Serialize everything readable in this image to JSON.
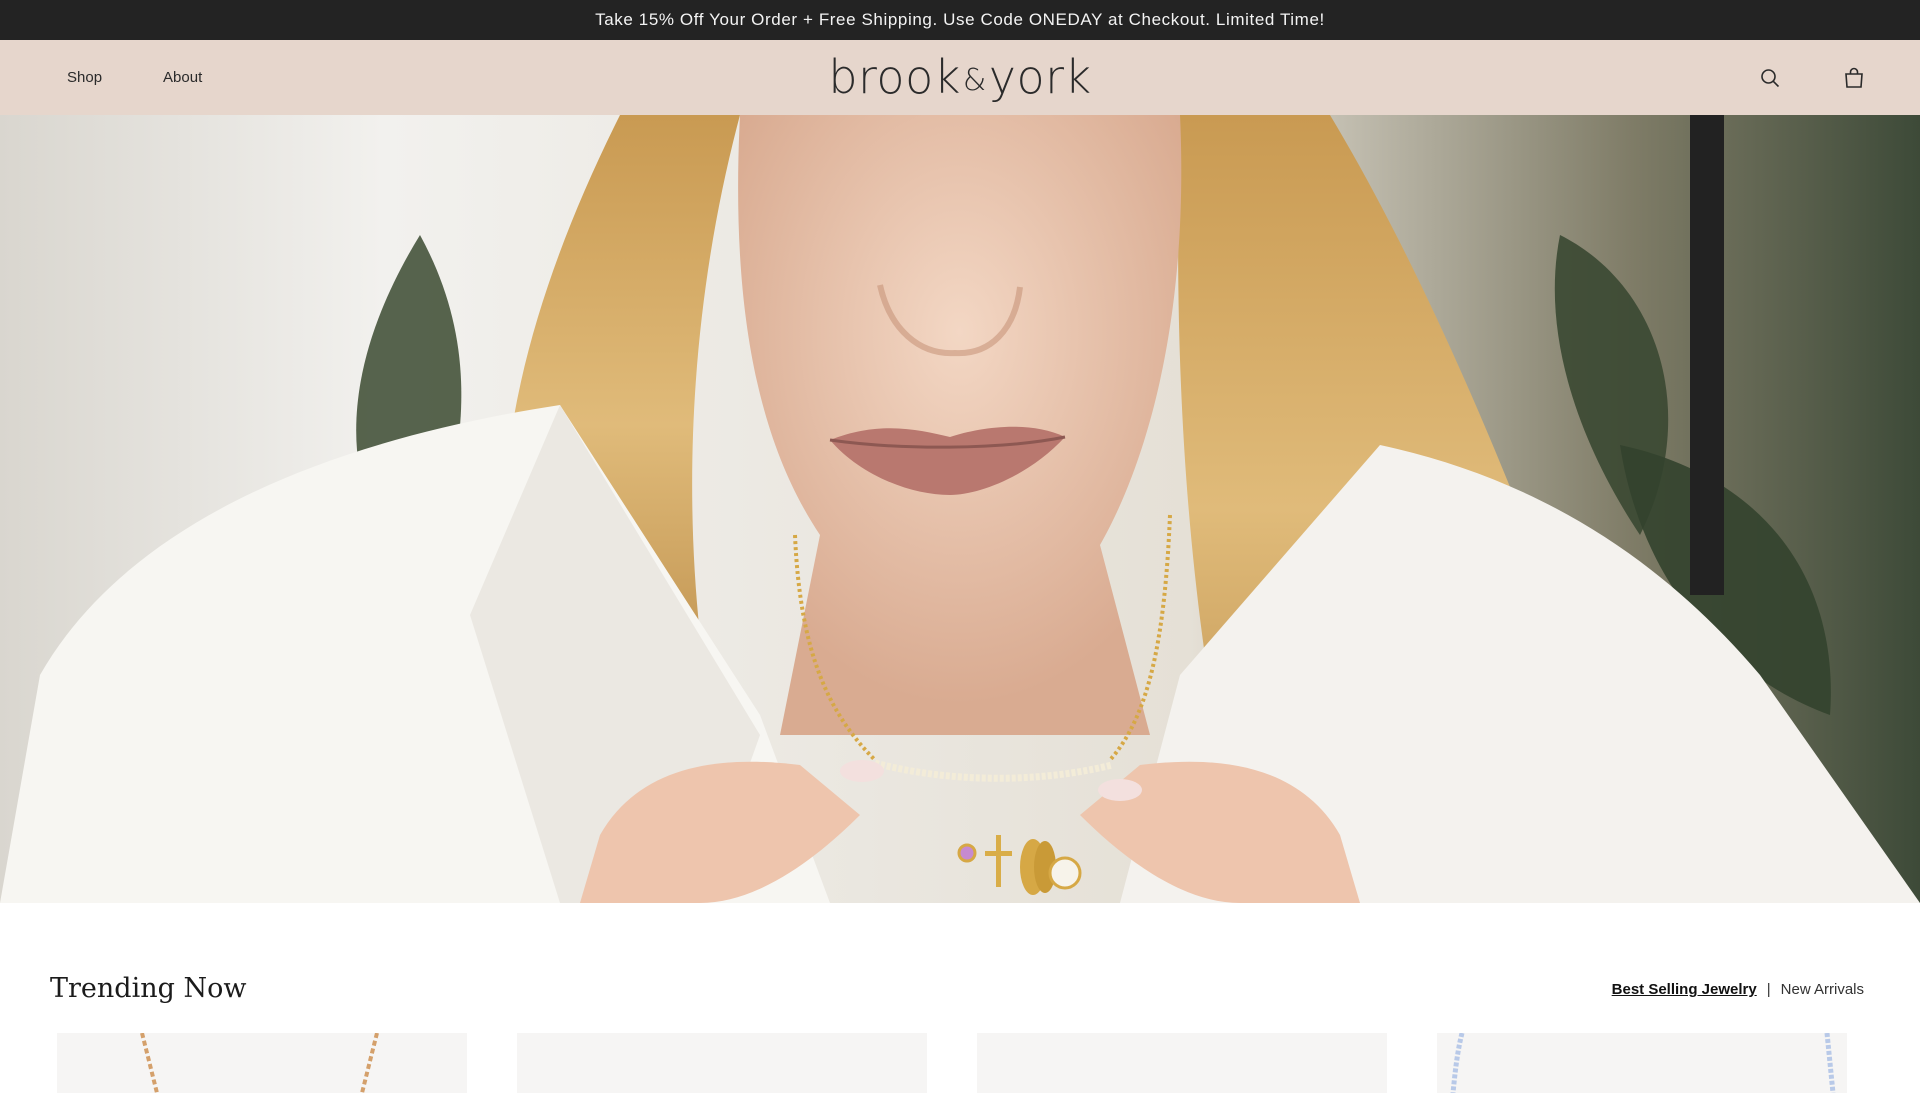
{
  "announcement": {
    "text": "Take 15% Off Your Order + Free Shipping. Use Code ONEDAY at Checkout. Limited Time!"
  },
  "header": {
    "nav": [
      {
        "label": "Shop"
      },
      {
        "label": "About"
      }
    ],
    "logo": {
      "part1": "brook",
      "amp": "&",
      "part2": "york"
    },
    "icons": [
      "search-icon",
      "cart-icon"
    ]
  },
  "hero": {
    "image": "woman-wearing-gold-charm-necklace"
  },
  "trending": {
    "title": "Trending Now",
    "tabs": [
      {
        "label": "Best Selling Jewelry",
        "active": true
      },
      {
        "label": "New Arrivals",
        "active": false
      }
    ],
    "separator": "|"
  },
  "colors": {
    "announcement_bg": "#232323",
    "header_bg": "#e6d6cc",
    "accent": "#d4a940"
  }
}
